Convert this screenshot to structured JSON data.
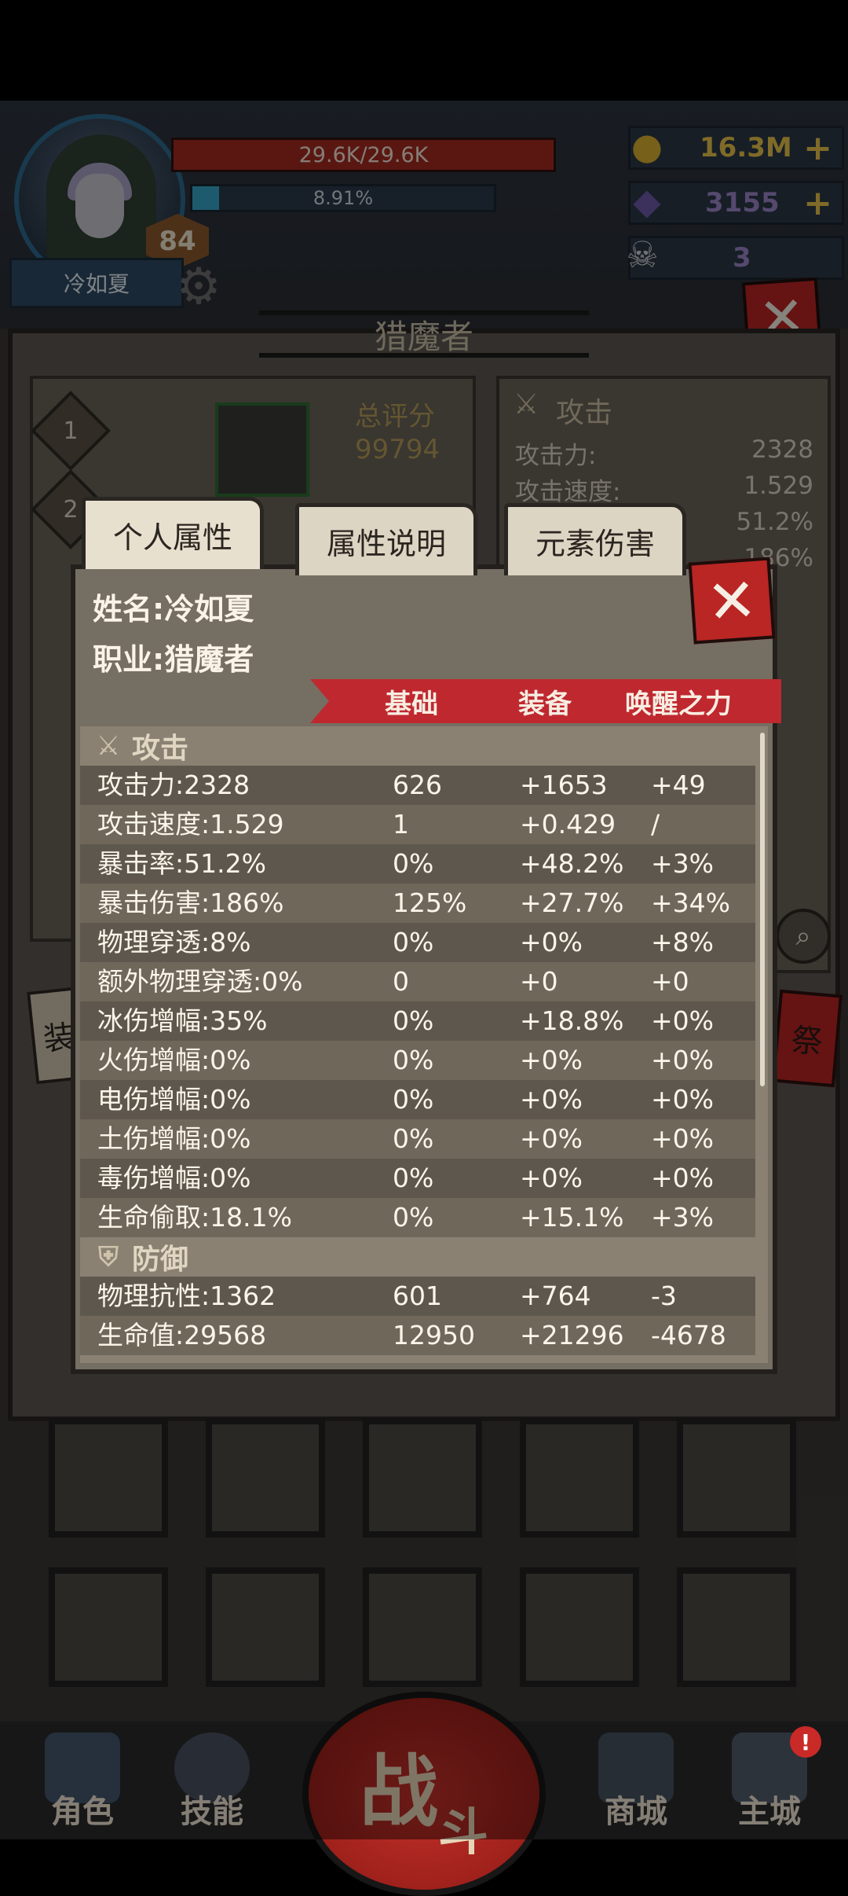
{
  "player": {
    "hp": "29.6K/29.6K",
    "hp_fraction": 1.0,
    "xp": "8.91%",
    "xp_fraction": 0.0891,
    "level": "84",
    "name": "冷如夏"
  },
  "currency": {
    "gold": "16.3M",
    "gems": "3155",
    "tokens": "3",
    "plus": "+"
  },
  "page_title": "猎魔者",
  "score_card": {
    "label": "总评分",
    "value": "99794",
    "slot1": "1",
    "slot2": "2"
  },
  "attack_card": {
    "title": "攻击",
    "rows": [
      {
        "label": "攻击力:",
        "value": "2328"
      },
      {
        "label": "攻击速度:",
        "value": "1.529"
      },
      {
        "label": "",
        "value": "51.2%"
      },
      {
        "label": "",
        "value": "186%"
      }
    ]
  },
  "side_labels": {
    "left": "装",
    "right": "祭"
  },
  "tabs": [
    "个人属性",
    "属性说明",
    "元素伤害"
  ],
  "modal": {
    "close": "✕",
    "name_label": "姓名:",
    "name_value": "冷如夏",
    "class_label": "职业:",
    "class_value": "猎魔者",
    "columns": [
      "基础",
      "装备",
      "唤醒之力"
    ],
    "sections": [
      {
        "title": "攻击",
        "icon": "crossed-swords-icon",
        "rows": [
          [
            "攻击力:2328",
            "626",
            "+1653",
            "+49"
          ],
          [
            "攻击速度:1.529",
            "1",
            "+0.429",
            "/"
          ],
          [
            "暴击率:51.2%",
            "0%",
            "+48.2%",
            "+3%"
          ],
          [
            "暴击伤害:186%",
            "125%",
            "+27.7%",
            "+34%"
          ],
          [
            "物理穿透:8%",
            "0%",
            "+0%",
            "+8%"
          ],
          [
            "额外物理穿透:0%",
            "0",
            "+0",
            "+0"
          ],
          [
            "冰伤增幅:35%",
            "0%",
            "+18.8%",
            "+0%"
          ],
          [
            "火伤增幅:0%",
            "0%",
            "+0%",
            "+0%"
          ],
          [
            "电伤增幅:0%",
            "0%",
            "+0%",
            "+0%"
          ],
          [
            "土伤增幅:0%",
            "0%",
            "+0%",
            "+0%"
          ],
          [
            "毒伤增幅:0%",
            "0%",
            "+0%",
            "+0%"
          ],
          [
            "生命偷取:18.1%",
            "0%",
            "+15.1%",
            "+3%"
          ]
        ]
      },
      {
        "title": "防御",
        "icon": "shield-icon",
        "rows": [
          [
            "物理抗性:1362",
            "601",
            "+764",
            "-3"
          ],
          [
            "生命值:29568",
            "12950",
            "+21296",
            "-4678"
          ]
        ]
      }
    ]
  },
  "bottom_nav": [
    {
      "label": "角色"
    },
    {
      "label": "技能"
    },
    {
      "label": "战斗",
      "label_a": "战",
      "label_b": "斗"
    },
    {
      "label": "商城"
    },
    {
      "label": "主城",
      "badge": "!"
    }
  ],
  "colors": {
    "hp_red": "#a52b22",
    "xp_cyan": "#37a4c7",
    "ribbon_red": "#c0282f",
    "gold": "#e7c24a",
    "gem_purple": "#9b86c9"
  }
}
